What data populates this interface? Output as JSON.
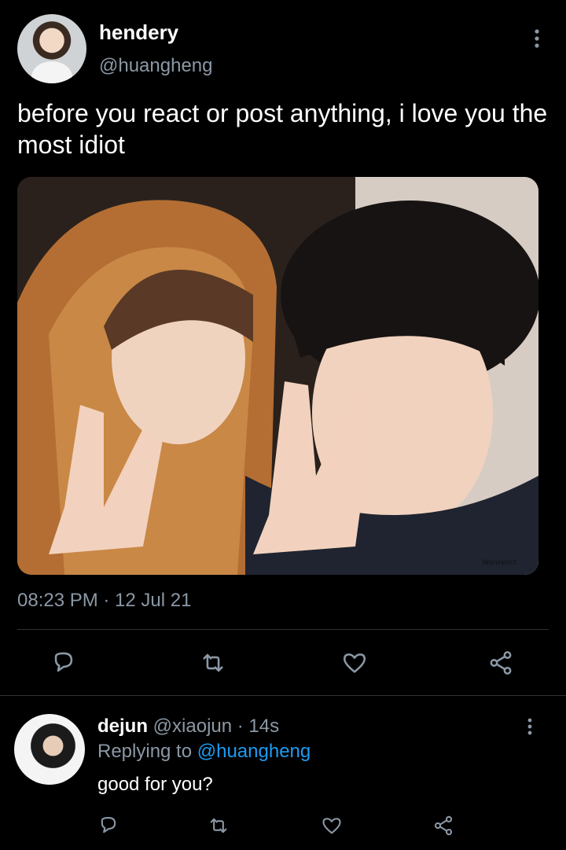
{
  "tweet": {
    "author_name": "hendery",
    "author_handle": "@huangheng",
    "text": "before you react or post anything, i love you the most idiot",
    "timestamp": "08:23 PM · 12 Jul 21",
    "photo_watermark": "Wonzenct",
    "icons": [
      "comment-icon",
      "retweet-icon",
      "like-icon",
      "share-icon",
      "more-icon"
    ]
  },
  "reply": {
    "author_name": "dejun",
    "author_handle": "@xiaojun",
    "age": "· 14s",
    "replying_prefix": "Replying to",
    "replying_handle": "@huangheng",
    "text": "good for you?"
  },
  "colors": {
    "background": "#000000",
    "text": "#ffffff",
    "muted": "#8b98a5",
    "link": "#1d9bf0",
    "divider": "#2f3336"
  }
}
